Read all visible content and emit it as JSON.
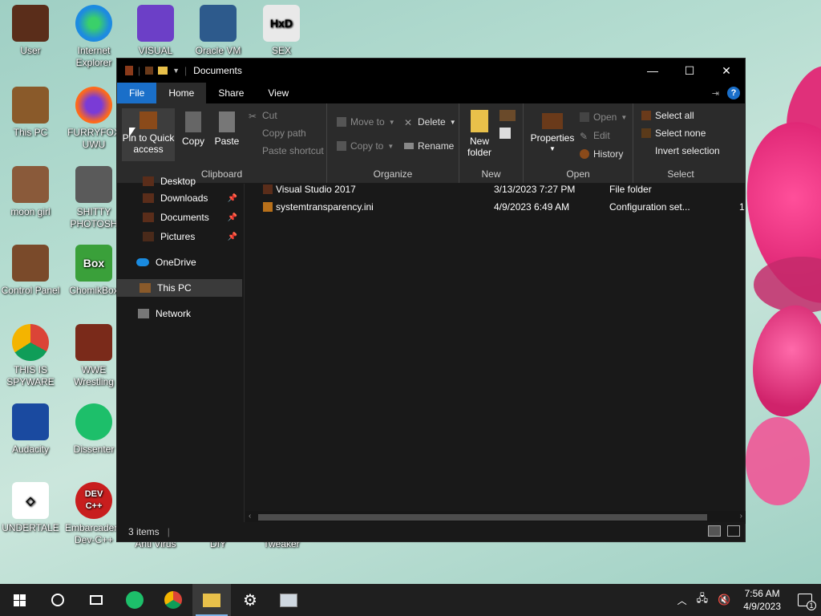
{
  "desktop": {
    "icons": [
      {
        "label": "User",
        "color": "#5a2d1a"
      },
      {
        "label": "Internet Explorer",
        "color": "#1d8be0"
      },
      {
        "label": "VISUAL",
        "color": "#6c3fc7"
      },
      {
        "label": "Oracle VM",
        "color": "#2d5a8c"
      },
      {
        "label": "SEX",
        "color": "#e1e1e1"
      },
      {
        "label": "This PC",
        "color": "#8a5a2a"
      },
      {
        "label": "FURRYFOX UWU",
        "color": "#ff6a1a"
      },
      {
        "label": "moon girl",
        "color": "#8a5a3a"
      },
      {
        "label": "SHITTY PHOTOSH",
        "color": "#5a5a5a"
      },
      {
        "label": "Control Panel",
        "color": "#7a4a2a"
      },
      {
        "label": "ChomikBox",
        "color": "#3aa03a"
      },
      {
        "label": "THIS IS SPYWARE",
        "color": "#f2f2f2"
      },
      {
        "label": "WWE Wrestling",
        "color": "#7a2a1a"
      },
      {
        "label": "Audacity",
        "color": "#1a4aa0"
      },
      {
        "label": "Dissenter",
        "color": "#1dbf6a"
      },
      {
        "label": "UNDERTALE",
        "color": "#ffffff"
      },
      {
        "label": "Embarcadero Dev-C++",
        "color": "#c81e1e"
      }
    ],
    "hidden_labels": [
      "Anti Virus",
      "DIY",
      "Tweaker"
    ]
  },
  "window": {
    "title": "Documents",
    "tabs": [
      "File",
      "Home",
      "Share",
      "View"
    ],
    "ribbon": {
      "clipboard": {
        "pin_label": "Pin to Quick access",
        "copy_label": "Copy",
        "paste_label": "Paste",
        "cut_label": "Cut",
        "copy_path_label": "Copy path",
        "paste_shortcut_label": "Paste shortcut",
        "group_label": "Clipboard"
      },
      "organize": {
        "move_to_label": "Move to",
        "copy_to_label": "Copy to",
        "delete_label": "Delete",
        "rename_label": "Rename",
        "group_label": "Organize"
      },
      "new": {
        "new_folder_label": "New folder",
        "group_label": "New"
      },
      "open": {
        "properties_label": "Properties",
        "open_label": "Open",
        "edit_label": "Edit",
        "history_label": "History",
        "group_label": "Open"
      },
      "select": {
        "select_all_label": "Select all",
        "select_none_label": "Select none",
        "invert_label": "Invert selection",
        "group_label": "Select"
      }
    },
    "nav": {
      "items": [
        {
          "label": "Desktop"
        },
        {
          "label": "Downloads"
        },
        {
          "label": "Documents"
        },
        {
          "label": "Pictures"
        },
        {
          "label": "OneDrive"
        },
        {
          "label": "This PC"
        },
        {
          "label": "Network"
        }
      ]
    },
    "files": [
      {
        "name": "Visual Studio 2017",
        "date": "3/13/2023 7:27 PM",
        "type": "File folder",
        "size": ""
      },
      {
        "name": "systemtransparency.ini",
        "date": "4/9/2023 6:49 AM",
        "type": "Configuration set...",
        "size": "1"
      }
    ],
    "status": {
      "items": "3 items"
    }
  },
  "taskbar": {
    "time": "7:56 AM",
    "date": "4/9/2023",
    "notification_count": "1"
  }
}
